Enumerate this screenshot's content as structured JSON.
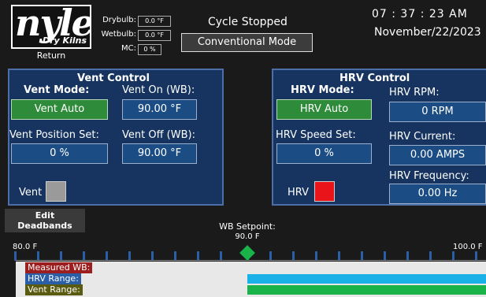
{
  "logo": {
    "brand": "nyle",
    "sub": "Dry Kilns",
    "return_label": "Return"
  },
  "sensors": [
    {
      "label": "Drybulb:",
      "value": "0.0 °F"
    },
    {
      "label": "Wetbulb:",
      "value": "0.0 °F"
    },
    {
      "label": "MC:",
      "value": "0 %"
    }
  ],
  "status": {
    "cycle": "Cycle Stopped",
    "mode": "Conventional Mode"
  },
  "clock": {
    "time": "07 : 37 : 23  AM",
    "date": "November/22/2023"
  },
  "vent": {
    "title": "Vent Control",
    "mode_label": "Vent Mode:",
    "mode_value": "Vent Auto",
    "on_label": "Vent On (WB):",
    "on_value": "90.00 °F",
    "position_label": "Vent Position Set:",
    "position_value": "0 %",
    "off_label": "Vent Off (WB):",
    "off_value": "90.00 °F",
    "indicator_label": "Vent",
    "indicator_color": "#9a9a9a"
  },
  "hrv": {
    "title": "HRV Control",
    "mode_label": "HRV Mode:",
    "mode_value": "HRV Auto",
    "rpm_label": "HRV RPM:",
    "rpm_value": "0 RPM",
    "speed_label": "HRV Speed Set:",
    "speed_value": "0 %",
    "current_label": "HRV Current:",
    "current_value": "0.00 AMPS",
    "freq_label": "HRV Frequency:",
    "freq_value": "0.00 Hz",
    "indicator_label": "HRV",
    "indicator_color": "#e8141a"
  },
  "deadbands": {
    "edit_label_1": "Edit",
    "edit_label_2": "Deadbands",
    "setpoint_label": "WB Setpoint:",
    "setpoint_value": "90.0 F",
    "scale_min": "80.0 F",
    "scale_max": "100.0 F",
    "measured_label": "Measured WB:",
    "hrv_range_label": "HRV Range:",
    "vent_range_label": "Vent Range:"
  },
  "colors": {
    "panel_bg": "#16345f",
    "auto_green": "#2e8b3a",
    "setpoint_green": "#19b34a",
    "hrv_range_blue": "#1ab0e8",
    "vent_range_green": "#19b34a",
    "measured_red": "#9c1e1e",
    "hrv_label_blue": "#2a5fa8",
    "vent_label_olive": "#5a5a10"
  }
}
